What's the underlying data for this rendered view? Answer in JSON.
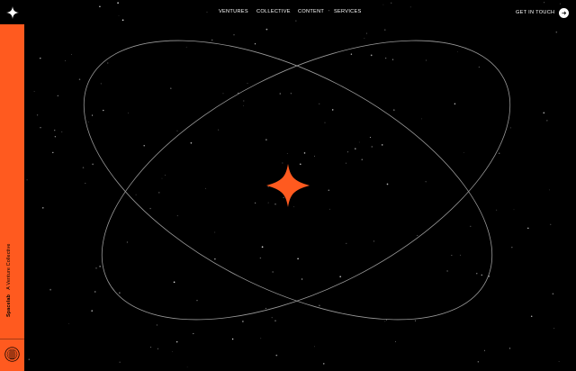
{
  "sidebar": {
    "brand_name": "Spacelab",
    "tagline": "A Venture Collective"
  },
  "nav": {
    "items": [
      {
        "label": "VENTURES"
      },
      {
        "label": "COLLECTIVE"
      },
      {
        "label": "CONTENT"
      },
      {
        "label": "SERVICES"
      }
    ]
  },
  "cta": {
    "label": "GET IN TOUCH"
  },
  "colors": {
    "accent": "#ff5a1f",
    "background": "#000000",
    "foreground": "#ffffff"
  },
  "icons": [
    "four-point-star-logo-icon",
    "seal-badge-icon",
    "arrow-right-icon",
    "orange-star-icon"
  ]
}
